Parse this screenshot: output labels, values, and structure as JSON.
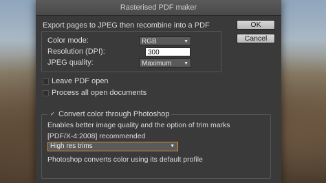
{
  "dialog": {
    "title": "Rasterised PDF maker",
    "description": "Export pages to JPEG then recombine into a PDF",
    "color_mode": {
      "label": "Color mode:",
      "value": "RGB"
    },
    "resolution": {
      "label": "Resolution (DPI):",
      "value": "300"
    },
    "jpeg_quality": {
      "label": "JPEG quality:",
      "value": "Maximum"
    },
    "leave_pdf_open": {
      "label": "Leave PDF open",
      "checked": false
    },
    "process_all": {
      "label": "Process all open documents",
      "checked": false
    },
    "convert_color": {
      "label": "Convert color through Photoshop",
      "checked": true,
      "check_glyph": "✓",
      "info": "Enables better image quality and the option of trim marks",
      "recommended": "[PDF/X-4:2008] recommended",
      "trim_option": "High res trims",
      "note": "Photoshop converts color using its default profile"
    },
    "ok_label": "OK",
    "cancel_label": "Cancel"
  },
  "icons": {
    "dropdown_arrow": "▼"
  }
}
